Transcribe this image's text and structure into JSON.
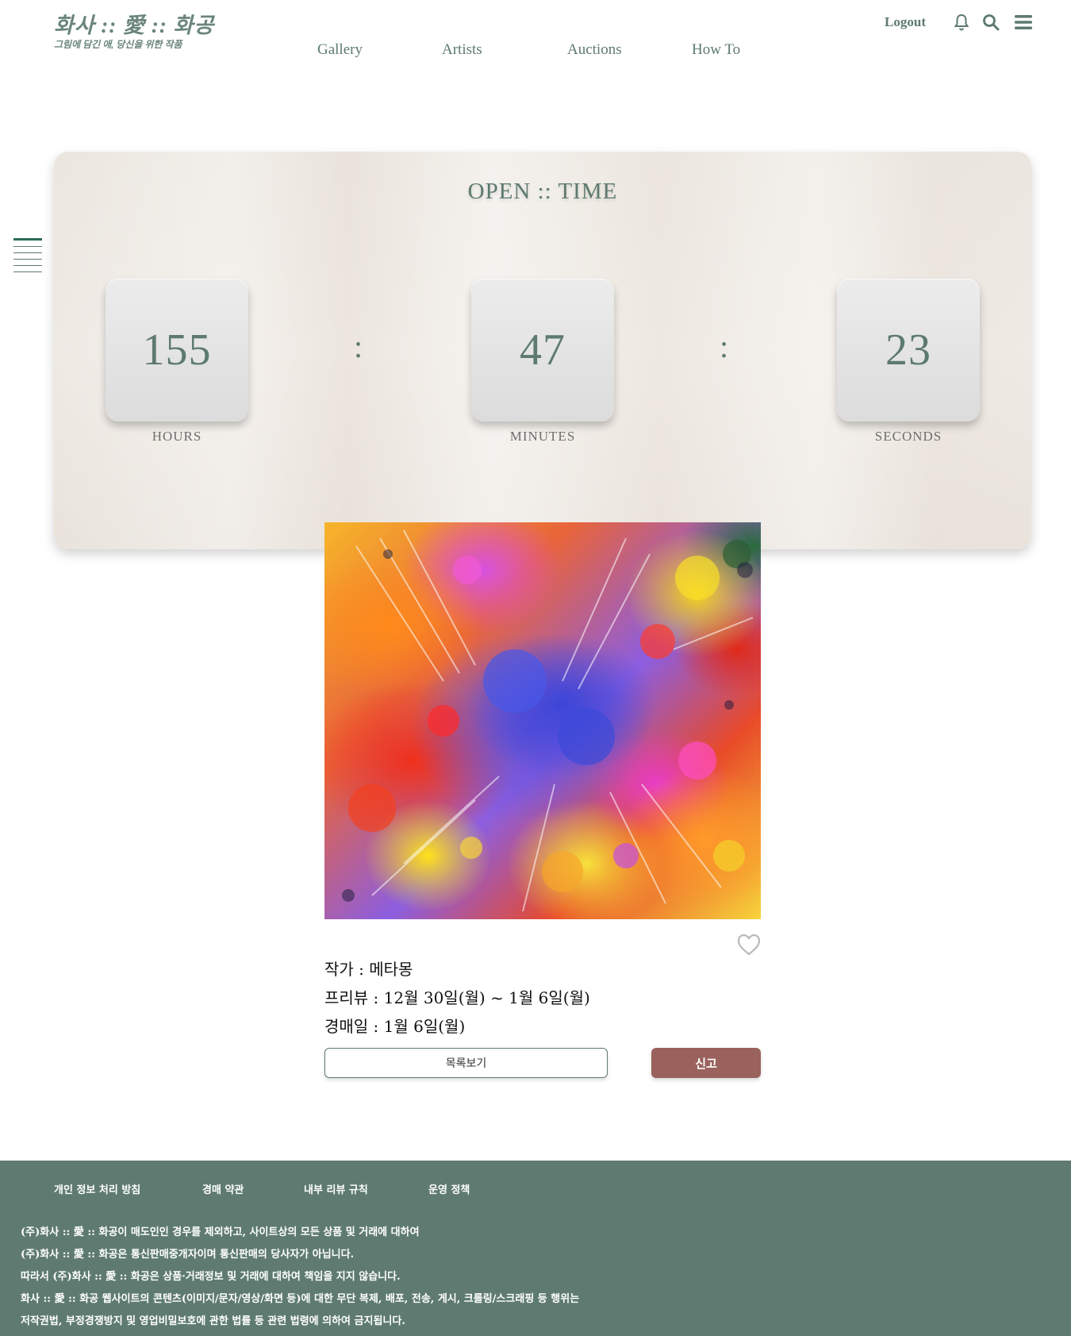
{
  "header": {
    "logo_title": "화사 :: 愛 :: 화공",
    "logo_subtitle": "그림에 담긴 애, 당신을 위한 작품",
    "nav": [
      "Gallery",
      "Artists",
      "Auctions",
      "How To"
    ],
    "logout_label": "Logout",
    "icons": [
      "bell-icon",
      "search-icon",
      "menu-icon"
    ]
  },
  "timer": {
    "title": "OPEN :: TIME",
    "hours": "155",
    "minutes": "47",
    "seconds": "23",
    "separator": ":",
    "hours_label": "HOURS",
    "minutes_label": "MINUTES",
    "seconds_label": "SECONDS"
  },
  "artwork": {
    "artist_line": "작가 : 메타몽",
    "preview_line": "프리뷰 : 12월 30일(월) ~ 1월 6일(월)",
    "auction_line": "경매일 : 1월 6일(월)",
    "list_button": "목록보기",
    "report_button": "신고",
    "like_icon": "heart-icon"
  },
  "footer": {
    "links": [
      "개인 정보 처리 방침",
      "경매 약관",
      "내부 리뷰 규칙",
      "운영 정책"
    ],
    "lines": [
      "(주)화사 :: 愛 :: 화공이 매도인인 경우를 제외하고, 사이트상의 모든 상품 및 거래에 대하여",
      "(주)화사 :: 愛 :: 화공은 통신판매중개자이며 통신판매의 당사자가 아닙니다.",
      "따라서 (주)화사 :: 愛 :: 화공은 상품·거래정보 및 거래에 대하여 책임을 지지 않습니다.",
      "화사 :: 愛 :: 화공 웹사이트의 콘텐츠(이미지/문자/영상/화면 등)에 대한 무단 복제, 배포, 전송, 게시, 크롤링/스크래핑 등 행위는",
      "저작권법, 부정경쟁방지 및 영업비밀보호에 관한 법률 등 관련 법령에 의하여 금지됩니다."
    ]
  },
  "colors": {
    "brand_green": "#5d7a6f",
    "footer_bg": "#5f7b71",
    "report_button": "#9a625c"
  }
}
